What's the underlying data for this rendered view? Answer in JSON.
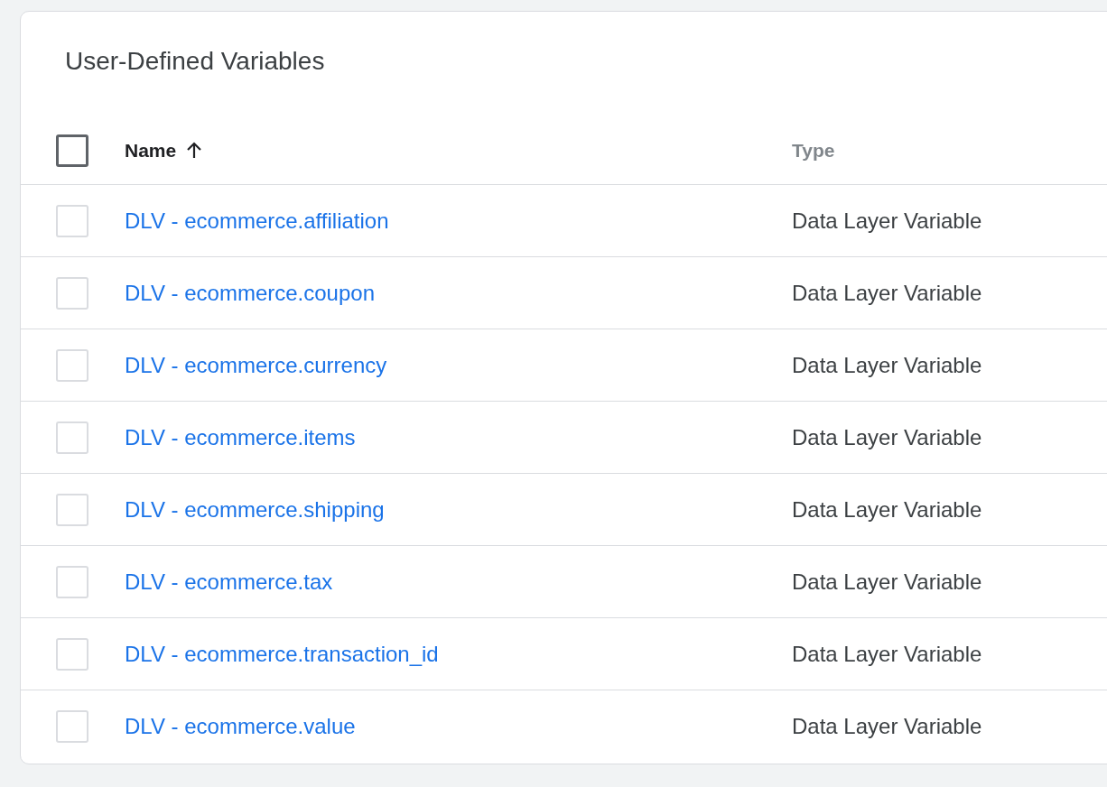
{
  "card": {
    "title": "User-Defined Variables"
  },
  "table": {
    "select_all": {
      "checked": false
    },
    "columns": [
      {
        "label": "Name",
        "sorted": true
      },
      {
        "label": "Type",
        "sorted": false
      }
    ],
    "rows": [
      {
        "name": "DLV - ecommerce.affiliation",
        "type": "Data Layer Variable",
        "checked": false
      },
      {
        "name": "DLV - ecommerce.coupon",
        "type": "Data Layer Variable",
        "checked": false
      },
      {
        "name": "DLV - ecommerce.currency",
        "type": "Data Layer Variable",
        "checked": false
      },
      {
        "name": "DLV - ecommerce.items",
        "type": "Data Layer Variable",
        "checked": false
      },
      {
        "name": "DLV - ecommerce.shipping",
        "type": "Data Layer Variable",
        "checked": false
      },
      {
        "name": "DLV - ecommerce.tax",
        "type": "Data Layer Variable",
        "checked": false
      },
      {
        "name": "DLV - ecommerce.transaction_id",
        "type": "Data Layer Variable",
        "checked": false
      },
      {
        "name": "DLV - ecommerce.value",
        "type": "Data Layer Variable",
        "checked": false
      }
    ]
  }
}
